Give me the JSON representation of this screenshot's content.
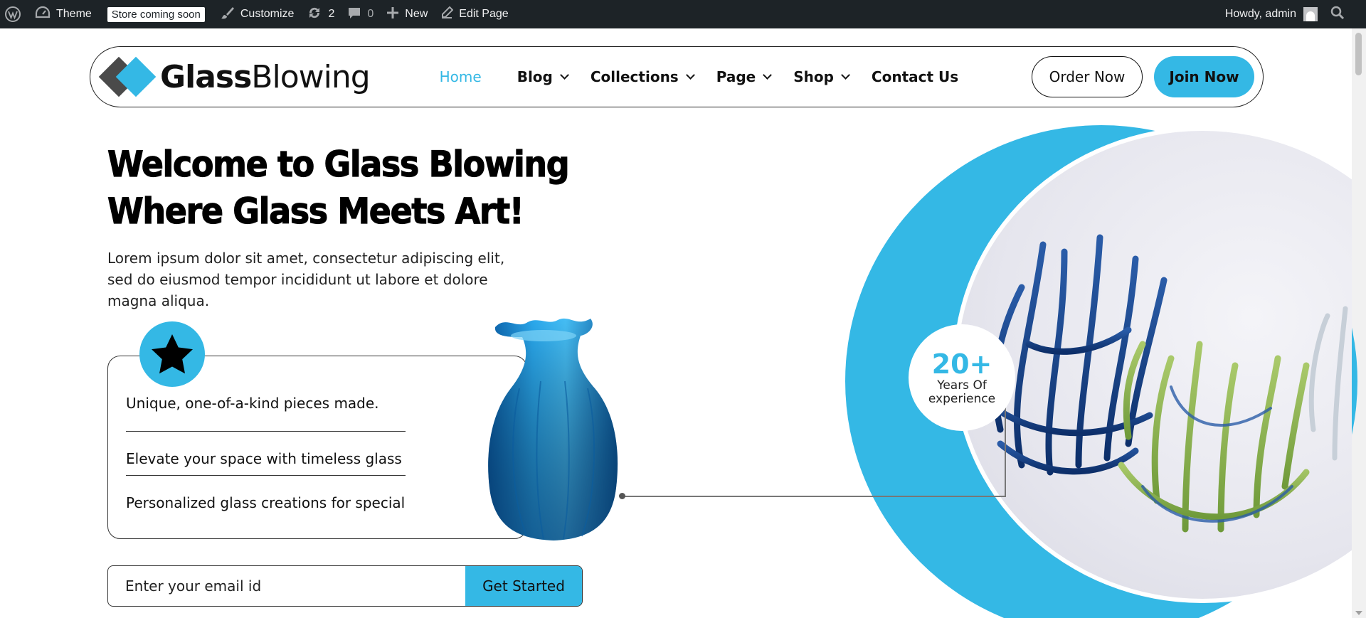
{
  "adminbar": {
    "theme_label": "Theme",
    "store_badge": "Store coming soon",
    "customize_label": "Customize",
    "updates_count": "2",
    "comments_count": "0",
    "new_label": "New",
    "edit_label": "Edit Page",
    "howdy": "Howdy, admin"
  },
  "header": {
    "logo_bold": "Glass",
    "logo_light": "Blowing",
    "nav": [
      {
        "label": "Home"
      },
      {
        "label": "Blog"
      },
      {
        "label": "Collections"
      },
      {
        "label": "Page"
      },
      {
        "label": "Shop"
      },
      {
        "label": "Contact Us"
      }
    ],
    "order_label": "Order Now",
    "join_label": "Join Now"
  },
  "hero": {
    "title_line1": "Welcome to Glass Blowing",
    "title_line2": "Where Glass Meets Art!",
    "description": "Lorem ipsum dolor sit amet, consectetur adipiscing elit, sed do eiusmod tempor incididunt ut labore et dolore magna aliqua.",
    "features": [
      "Unique, one-of-a-kind pieces made.",
      "Elevate your space with timeless glass",
      "Personalized glass creations for special"
    ],
    "email_placeholder": "Enter your email id",
    "cta_label": "Get Started"
  },
  "experience": {
    "number": "20+",
    "label_line1": "Years Of",
    "label_line2": "experience"
  },
  "colors": {
    "accent": "#34b8e5",
    "adminbar": "#1d2327",
    "logo_dark": "#4a4a4a"
  }
}
